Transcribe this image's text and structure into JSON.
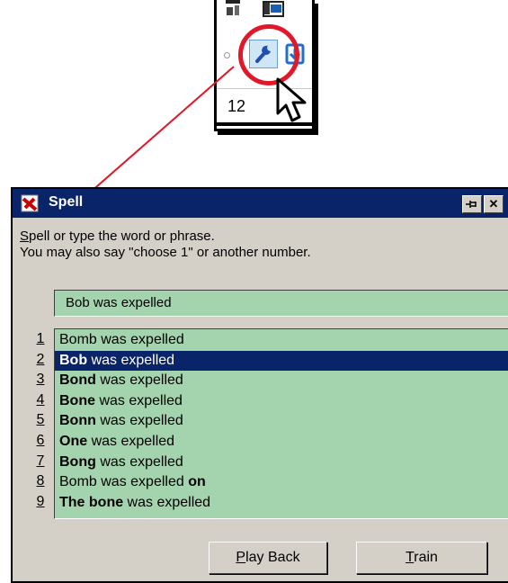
{
  "inset": {
    "count_value": "12",
    "icons": [
      "speak-icon",
      "notes-icon",
      "wrench-icon",
      "blue-action-icon",
      "mouse-cursor-icon"
    ]
  },
  "dialog": {
    "title": "Spell",
    "title_buttons": [
      "pin-icon",
      "close-icon"
    ],
    "instruction_line1_hotkey": "S",
    "instruction_line1_rest": "pell or type the word or phrase.",
    "instruction_line2": "You may also say \"choose 1\" or another number.",
    "input_value": "Bob was expelled",
    "selected_index": 1,
    "numbers": [
      "1",
      "2",
      "3",
      "4",
      "5",
      "6",
      "7",
      "8",
      "9"
    ],
    "items": [
      {
        "bold": "",
        "rest": "Bomb was expelled"
      },
      {
        "bold": "Bob",
        "rest": " was expelled"
      },
      {
        "bold": "Bond",
        "rest": " was expelled"
      },
      {
        "bold": "Bone",
        "rest": " was expelled"
      },
      {
        "bold": "Bonn",
        "rest": " was expelled"
      },
      {
        "bold": "One",
        "rest": " was expelled"
      },
      {
        "bold": "Bong",
        "rest": " was expelled"
      },
      {
        "bold": "",
        "rest": "Bomb was expelled ",
        "bold_end": "on"
      },
      {
        "bold": "The bone",
        "rest": " was expelled"
      }
    ],
    "playback_hotkey": "P",
    "playback_rest": "lay Back",
    "train_hotkey": "T",
    "train_rest": "rain"
  },
  "colors": {
    "titlebar": "#0a246a",
    "list_bg": "#a3d4ad",
    "highlight": "#e0182a"
  }
}
